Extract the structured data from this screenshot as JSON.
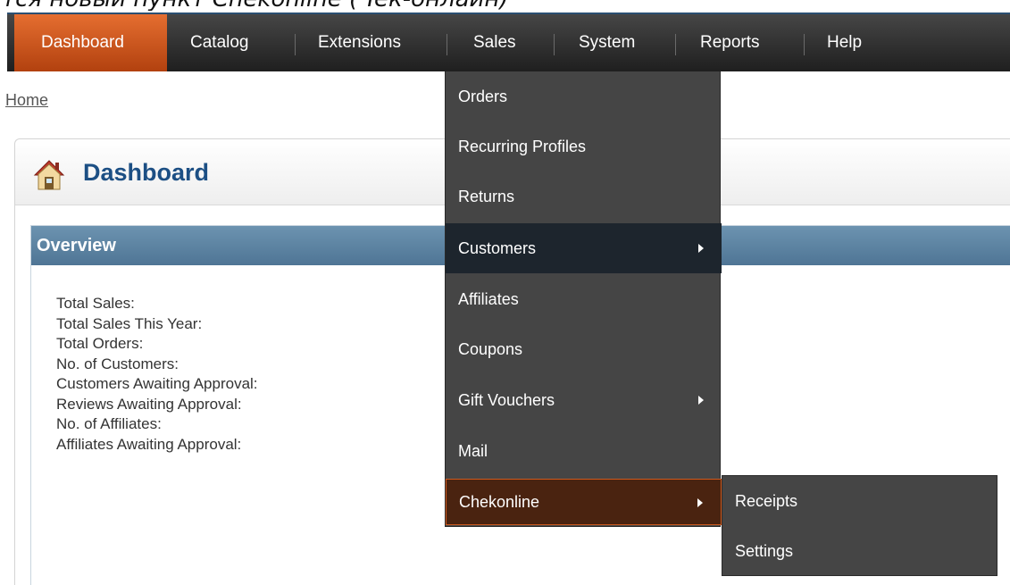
{
  "caption": "тся новый пункт Chekonline (Чек-онлайн)",
  "nav": {
    "items": [
      "Dashboard",
      "Catalog",
      "Extensions",
      "Sales",
      "System",
      "Reports",
      "Help"
    ]
  },
  "breadcrumb": "Home",
  "dashboard": {
    "title": "Dashboard"
  },
  "overview": {
    "title": "Overview",
    "rows": [
      "Total Sales:",
      "Total Sales This Year:",
      "Total Orders:",
      "No. of Customers:",
      "Customers Awaiting Approval:",
      "Reviews Awaiting Approval:",
      "No. of Affiliates:",
      "Affiliates Awaiting Approval:"
    ]
  },
  "sales_menu": {
    "items": [
      "Orders",
      "Recurring Profiles",
      "Returns",
      "Customers",
      "Affiliates",
      "Coupons",
      "Gift Vouchers",
      "Mail",
      "Chekonline"
    ]
  },
  "chekonline_submenu": {
    "items": [
      "Receipts",
      "Settings"
    ]
  },
  "colors": {
    "accent": "#e56e30",
    "nav": "#2f2f2f",
    "panel_head": "#5b81a1",
    "title": "#1c4f84"
  },
  "icons": [
    "home-icon",
    "chevron-right-icon"
  ]
}
